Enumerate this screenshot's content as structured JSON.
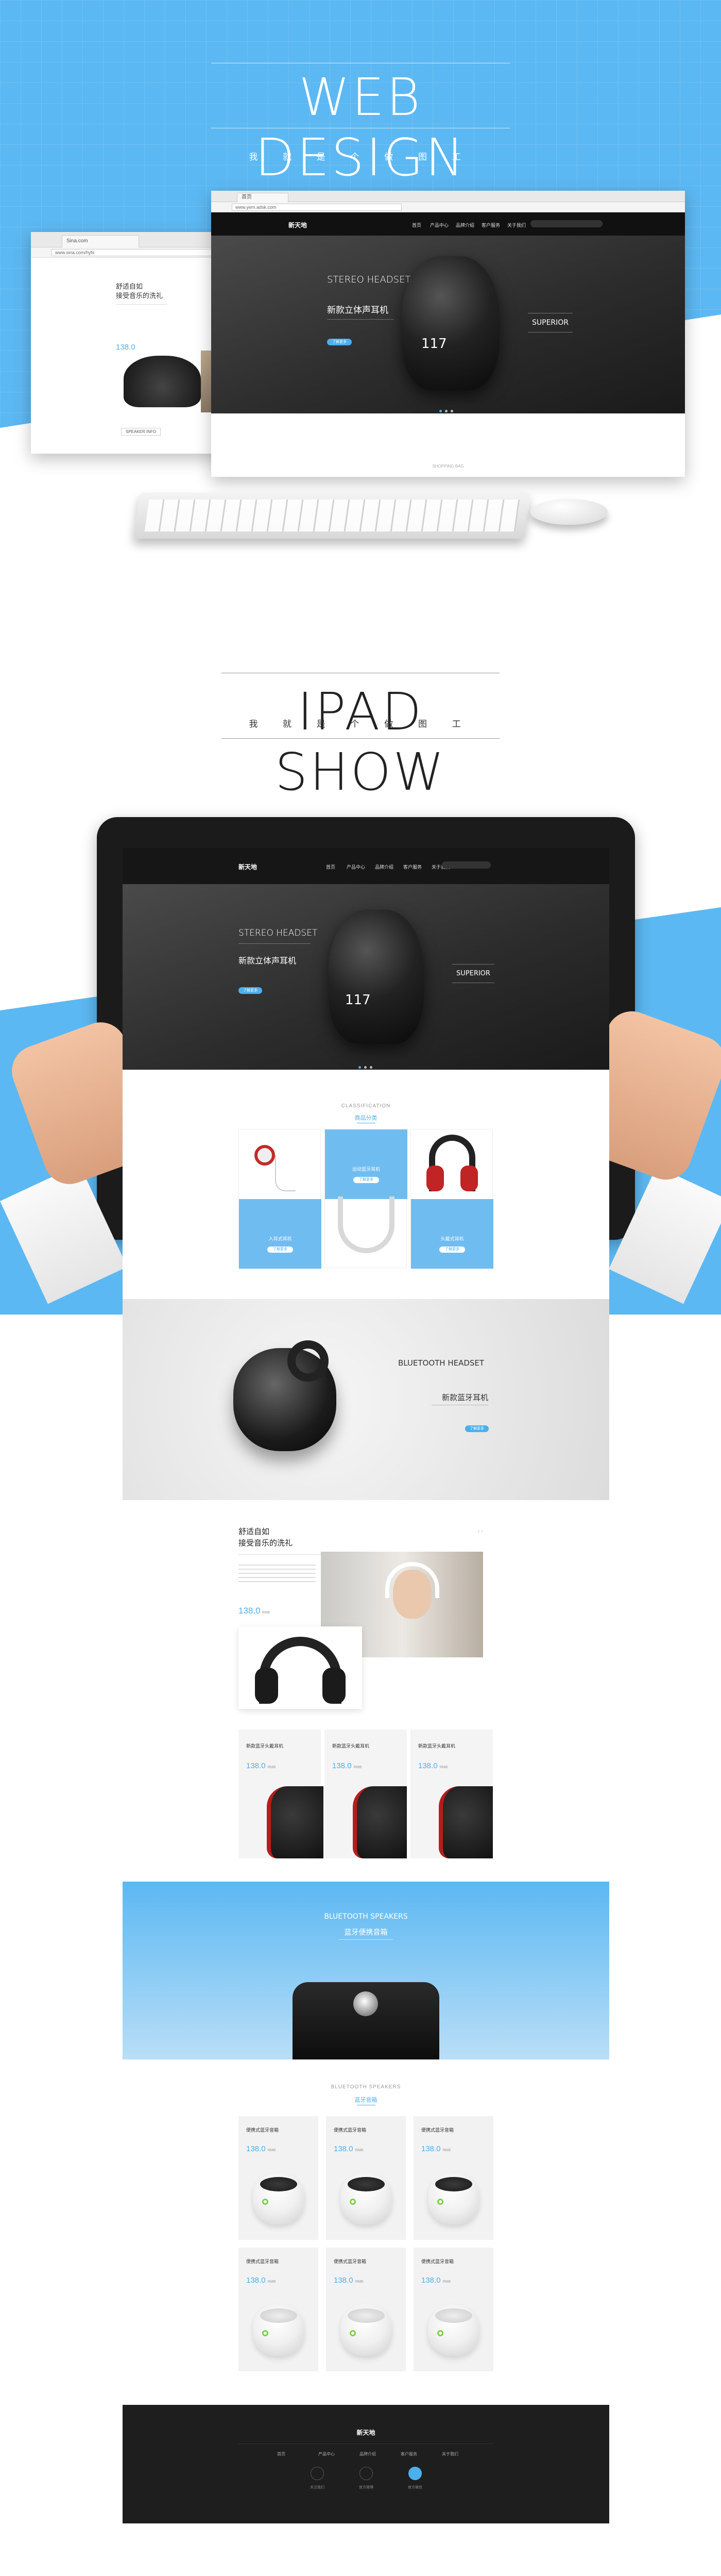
{
  "hero": {
    "title": "WEB DESIGN",
    "subtitle": "我 就 是 个 做 图 工",
    "bg_color": "#5cb8f2"
  },
  "browser_back": {
    "tab": "Sina.com",
    "url": "www.sina.com/hyfs",
    "heading_line1": "舒适自如",
    "heading_line2": "接受音乐的洗礼",
    "price": "138.0",
    "caption": "SPEAKER INFO"
  },
  "browser_front": {
    "tab": "首页",
    "url": "www.yem.adsk.com",
    "logo": "新天地",
    "nav": [
      "首页",
      "产品中心",
      "品牌介绍",
      "客户服务",
      "关于我们"
    ],
    "banner_en": "STEREO HEADSET",
    "banner_cn": "新款立体声耳机",
    "banner_btn": "了解更多",
    "headset_number": "117",
    "superior": "SUPERIOR",
    "section_caption": "SHOPPING BAG"
  },
  "ipad_section": {
    "title": "IPAD SHOW",
    "subtitle": "我 就 是 个 做 图 工"
  },
  "screen": {
    "logo": "新天地",
    "nav": [
      "首页",
      "产品中心",
      "品牌介绍",
      "客户服务",
      "关于我们"
    ],
    "banner_en": "STEREO HEADSET",
    "banner_cn": "新款立体声耳机",
    "banner_btn": "了解更多",
    "headset_number": "117",
    "superior": "SUPERIOR",
    "categories_title_en": "CLASSIFICATION",
    "categories_title_cn": "商品分类",
    "categories": [
      {
        "label": "入耳式耳机",
        "btn": "了解更多"
      },
      {
        "label": "运动蓝牙耳机",
        "btn": "了解更多"
      },
      {
        "label": "头戴式耳机",
        "btn": "了解更多"
      }
    ],
    "bt_headset_en": "BLUETOOTH HEADSET",
    "bt_headset_cn": "新款蓝牙耳机",
    "bt_headset_btn": "了解更多",
    "feature_line1": "舒适自如",
    "feature_line2": "接受音乐的洗礼",
    "feature_price": "138.0",
    "feature_price_unit": "RMB",
    "products": [
      {
        "title": "新款蓝牙头戴耳机",
        "price": "138.0",
        "unit": "RMB"
      },
      {
        "title": "新款蓝牙头戴耳机",
        "price": "138.0",
        "unit": "RMB"
      },
      {
        "title": "新款蓝牙头戴耳机",
        "price": "138.0",
        "unit": "RMB"
      }
    ],
    "speakers_banner_en": "BLUETOOTH SPEAKERS",
    "speakers_banner_cn": "蓝牙便携音箱",
    "speakers_title_en": "BLUETOOTH SPEAKERS",
    "speakers_title_cn": "蓝牙音箱",
    "speakers": [
      {
        "title": "便携式蓝牙音箱",
        "price": "138.0",
        "unit": "RMB"
      },
      {
        "title": "便携式蓝牙音箱",
        "price": "138.0",
        "unit": "RMB"
      },
      {
        "title": "便携式蓝牙音箱",
        "price": "138.0",
        "unit": "RMB"
      },
      {
        "title": "便携式蓝牙音箱",
        "price": "138.0",
        "unit": "RMB"
      },
      {
        "title": "便携式蓝牙音箱",
        "price": "138.0",
        "unit": "RMB"
      },
      {
        "title": "便携式蓝牙音箱",
        "price": "138.0",
        "unit": "RMB"
      }
    ],
    "footer_logo": "新天地",
    "footer_nav": [
      "首页",
      "产品中心",
      "品牌介绍",
      "客户服务",
      "关于我们"
    ],
    "footer_icons": [
      {
        "icon": "user-icon",
        "label": "关注我们"
      },
      {
        "icon": "weibo-icon",
        "label": "官方微博"
      },
      {
        "icon": "wechat-icon",
        "label": "官方微信"
      }
    ]
  },
  "colors": {
    "accent": "#4ab0ee",
    "hero_blue": "#5cb8f2",
    "dark_nav": "#111111"
  }
}
